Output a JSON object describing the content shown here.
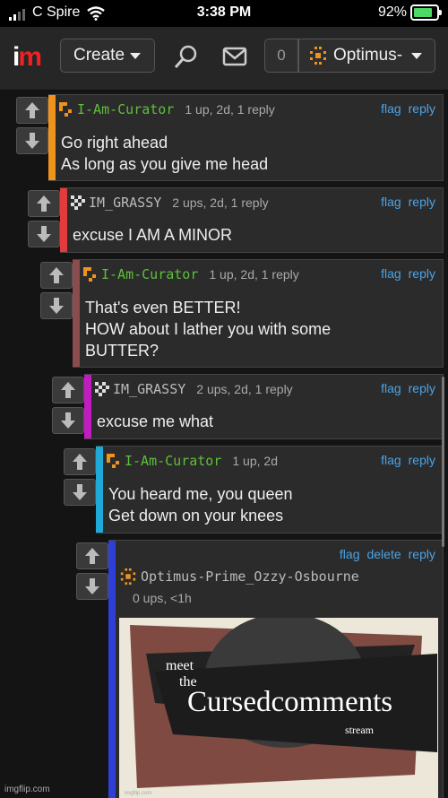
{
  "status_bar": {
    "carrier": "C Spire",
    "time": "3:38 PM",
    "battery": "92%"
  },
  "header": {
    "create_label": "Create",
    "notification_count": "0",
    "username": "Optimus-"
  },
  "comments": [
    {
      "user": "I-Am-Curator",
      "meta": "1 up, 2d, 1 reply",
      "actions": [
        "flag",
        "reply"
      ],
      "lines": [
        "Go right ahead",
        "As long as you give me head"
      ],
      "bar_color": "#f0921e"
    },
    {
      "user": "IM_GRASSY",
      "meta": "2 ups, 2d, 1 reply",
      "actions": [
        "flag",
        "reply"
      ],
      "lines": [
        "excuse I AM A MINOR"
      ],
      "bar_color": "#e23b3b"
    },
    {
      "user": "I-Am-Curator",
      "meta": "1 up, 2d, 1 reply",
      "actions": [
        "flag",
        "reply"
      ],
      "lines": [
        "That's even BETTER!",
        "HOW about I lather you with some",
        "BUTTER?"
      ],
      "bar_color": "#8a4c4c"
    },
    {
      "user": "IM_GRASSY",
      "meta": "2 ups, 2d, 1 reply",
      "actions": [
        "flag",
        "reply"
      ],
      "lines": [
        "excuse me what"
      ],
      "bar_color": "#c21bc2"
    },
    {
      "user": "I-Am-Curator",
      "meta": "1 up, 2d",
      "actions": [
        "flag",
        "reply"
      ],
      "lines": [
        "You heard me, you queen",
        "Get down on your knees"
      ],
      "bar_color": "#1fa9d6"
    },
    {
      "user": "Optimus-Prime_Ozzy-Osbourne",
      "meta": "0 ups, <1h",
      "actions": [
        "flag",
        "delete",
        "reply"
      ],
      "lines": [],
      "bar_color": "#2f3fd6"
    }
  ],
  "meme_image": {
    "line1": "meet",
    "line2": "the",
    "title": "Cursedcomments",
    "subtitle": "stream",
    "watermark": "imgflip.com"
  },
  "footer": "imgflip.com"
}
